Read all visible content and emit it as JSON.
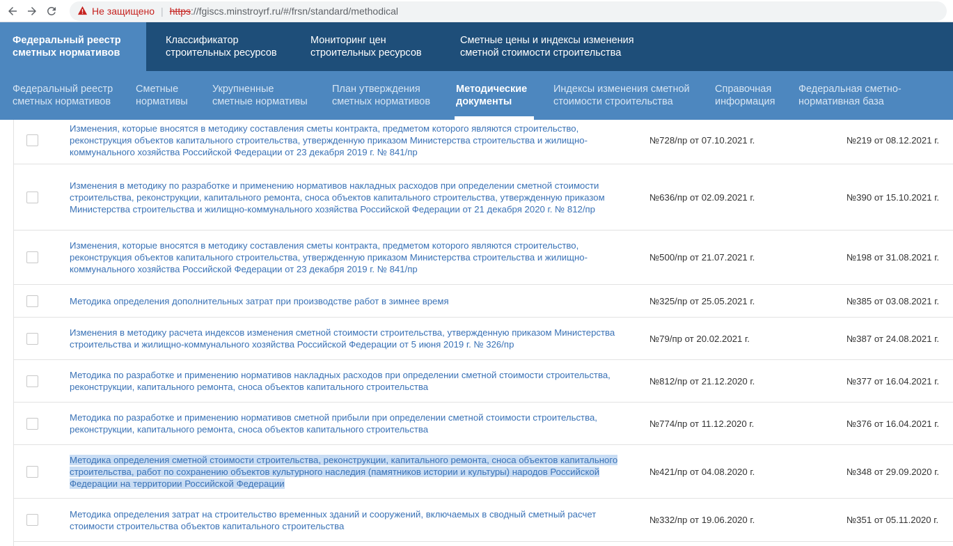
{
  "browser": {
    "security_label": "Не защищено",
    "url_scheme": "https",
    "url_rest": "://fgiscs.minstroyrf.ru/#/frsn/standard/methodical"
  },
  "top_nav": [
    {
      "label": "Федеральный реестр\nсметных нормативов"
    },
    {
      "label": "Классификатор\nстроительных ресурсов"
    },
    {
      "label": "Мониторинг цен\nстроительных ресурсов"
    },
    {
      "label": "Сметные цены и индексы изменения\nсметной стоимости строительства"
    }
  ],
  "sub_nav": [
    {
      "label": "Федеральный реестр\nсметных нормативов"
    },
    {
      "label": "Сметные\nнормативы"
    },
    {
      "label": "Укрупненные\nсметные нормативы"
    },
    {
      "label": "План утверждения\nсметных нормативов"
    },
    {
      "label": "Методические\nдокументы"
    },
    {
      "label": "Индексы изменения сметной\nстоимости строительства"
    },
    {
      "label": "Справочная\nинформация"
    },
    {
      "label": "Федеральная сметно-\nнормативная база"
    }
  ],
  "rows": [
    {
      "title": "Изменения, которые вносятся в методику составления сметы контракта, предметом которого являются строительство, реконструкция объектов капитального строительства, утвержденную приказом Министерства строительства и жилищно-коммунального хозяйства Российской Федерации от 23 декабря 2019 г. № 841/пр",
      "order": "№728/пр от 07.10.2021 г.",
      "reg": "№219 от 08.12.2021 г."
    },
    {
      "title": "Изменения в методику по разработке и применению нормативов накладных расходов при определении сметной стоимости строительства, реконструкции, капитального ремонта, сноса объектов капитального строительства, утвержденную приказом Министерства строительства и жилищно-коммунального хозяйства Российской Федерации от 21 декабря 2020 г. № 812/пр",
      "order": "№636/пр от 02.09.2021 г.",
      "reg": "№390 от 15.10.2021 г."
    },
    {
      "title": "Изменения, которые вносятся в методику составления сметы контракта, предметом которого являются строительство, реконструкция объектов капитального строительства, утвержденную приказом Министерства строительства и жилищно-коммунального хозяйства Российской Федерации от 23 декабря 2019 г. № 841/пр",
      "order": "№500/пр от 21.07.2021 г.",
      "reg": "№198 от 31.08.2021 г."
    },
    {
      "title": "Методика определения дополнительных затрат при производстве работ в зимнее время",
      "order": "№325/пр от 25.05.2021 г.",
      "reg": "№385 от 03.08.2021 г."
    },
    {
      "title": "Изменения в методику расчета индексов изменения сметной стоимости строительства, утвержденную приказом Министерства строительства и жилищно-коммунального хозяйства Российской Федерации от 5 июня 2019 г. № 326/пр",
      "order": "№79/пр от 20.02.2021 г.",
      "reg": "№387 от 24.08.2021 г."
    },
    {
      "title": "Методика по разработке и применению нормативов накладных расходов при определении сметной стоимости строительства, реконструкции, капитального ремонта, сноса объектов капитального строительства",
      "order": "№812/пр от 21.12.2020 г.",
      "reg": "№377 от 16.04.2021 г."
    },
    {
      "title": "Методика по разработке и применению нормативов сметной прибыли при определении сметной стоимости строительства, реконструкции, капитального ремонта, сноса объектов капитального строительства",
      "order": "№774/пр от 11.12.2020 г.",
      "reg": "№376 от 16.04.2021 г."
    },
    {
      "title": "Методика определения сметной стоимости строительства, реконструкции, капитального ремонта, сноса объектов капитального строительства, работ по сохранению объектов культурного наследия (памятников истории и культуры) народов Российской Федерации на территории Российской Федерации",
      "order": "№421/пр от 04.08.2020 г.",
      "reg": "№348 от 29.09.2020 г."
    },
    {
      "title": "Методика определения затрат на строительство временных зданий и сооружений, включаемых в сводный сметный расчет стоимости строительства объектов капитального строительства",
      "order": "№332/пр от 19.06.2020 г.",
      "reg": "№351 от 05.11.2020 г."
    }
  ]
}
